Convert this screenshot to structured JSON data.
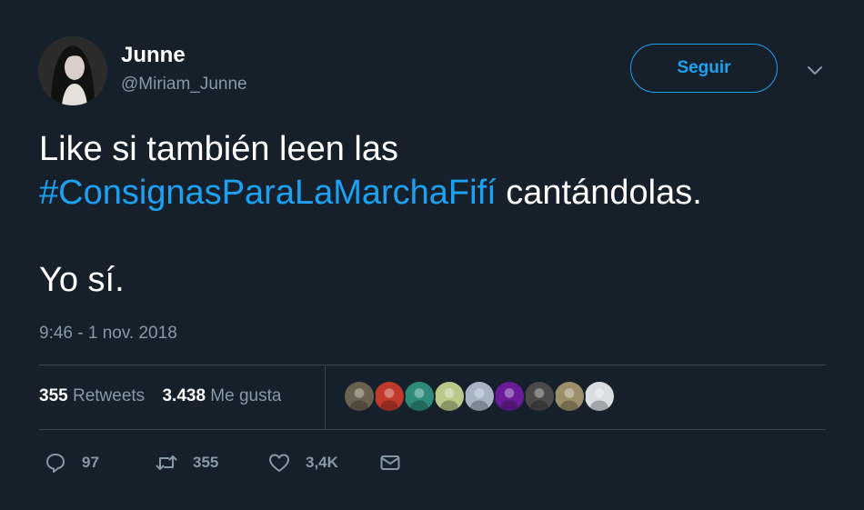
{
  "tweet": {
    "author": {
      "display_name": "Junne",
      "handle": "@Miriam_Junne"
    },
    "follow_label": "Seguir",
    "text": {
      "line1": "Like si también leen las",
      "hashtag": "#ConsignasParaLaMarchaFifí",
      "line2_rest": " cantándolas.",
      "line3": "Yo sí."
    },
    "timestamp": "9:46 - 1 nov. 2018",
    "stats": {
      "retweets_count": "355",
      "retweets_label": "Retweets",
      "likes_count": "3.438",
      "likes_label": "Me gusta"
    },
    "liker_avatars": [
      {
        "name": "liker-avatar-1",
        "color": "#6b6150"
      },
      {
        "name": "liker-avatar-2",
        "color": "#c0392b"
      },
      {
        "name": "liker-avatar-3",
        "color": "#2e8b7a"
      },
      {
        "name": "liker-avatar-4",
        "color": "#b9c98a"
      },
      {
        "name": "liker-avatar-5",
        "color": "#a7b4c4"
      },
      {
        "name": "liker-avatar-6",
        "color": "#6a1b9a"
      },
      {
        "name": "liker-avatar-7",
        "color": "#4a4a4a"
      },
      {
        "name": "liker-avatar-8",
        "color": "#9c8f6a"
      },
      {
        "name": "liker-avatar-9",
        "color": "#d9dee3"
      }
    ],
    "actions": {
      "reply_count": "97",
      "retweet_count": "355",
      "like_count": "3,4K"
    },
    "colors": {
      "background": "#15202b",
      "accent": "#1da1f2",
      "secondary_text": "#8899a6",
      "divider": "#38444d"
    }
  }
}
